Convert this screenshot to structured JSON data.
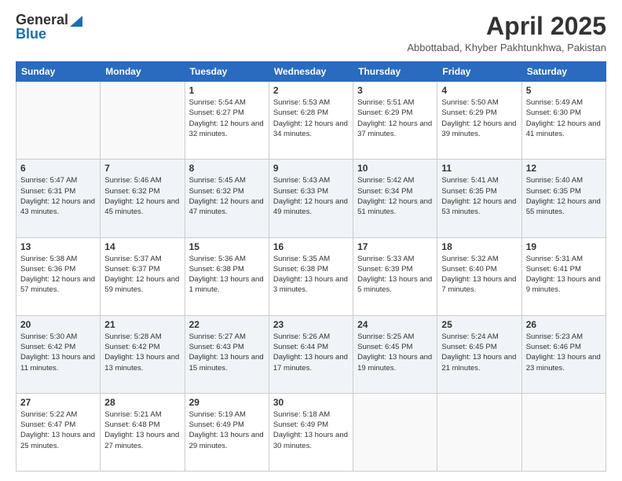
{
  "logo": {
    "general": "General",
    "blue": "Blue"
  },
  "title": {
    "month": "April 2025",
    "location": "Abbottabad, Khyber Pakhtunkhwa, Pakistan"
  },
  "days_of_week": [
    "Sunday",
    "Monday",
    "Tuesday",
    "Wednesday",
    "Thursday",
    "Friday",
    "Saturday"
  ],
  "weeks": [
    [
      {
        "day": "",
        "info": ""
      },
      {
        "day": "",
        "info": ""
      },
      {
        "day": "1",
        "info": "Sunrise: 5:54 AM\nSunset: 6:27 PM\nDaylight: 12 hours and 32 minutes."
      },
      {
        "day": "2",
        "info": "Sunrise: 5:53 AM\nSunset: 6:28 PM\nDaylight: 12 hours and 34 minutes."
      },
      {
        "day": "3",
        "info": "Sunrise: 5:51 AM\nSunset: 6:29 PM\nDaylight: 12 hours and 37 minutes."
      },
      {
        "day": "4",
        "info": "Sunrise: 5:50 AM\nSunset: 6:29 PM\nDaylight: 12 hours and 39 minutes."
      },
      {
        "day": "5",
        "info": "Sunrise: 5:49 AM\nSunset: 6:30 PM\nDaylight: 12 hours and 41 minutes."
      }
    ],
    [
      {
        "day": "6",
        "info": "Sunrise: 5:47 AM\nSunset: 6:31 PM\nDaylight: 12 hours and 43 minutes."
      },
      {
        "day": "7",
        "info": "Sunrise: 5:46 AM\nSunset: 6:32 PM\nDaylight: 12 hours and 45 minutes."
      },
      {
        "day": "8",
        "info": "Sunrise: 5:45 AM\nSunset: 6:32 PM\nDaylight: 12 hours and 47 minutes."
      },
      {
        "day": "9",
        "info": "Sunrise: 5:43 AM\nSunset: 6:33 PM\nDaylight: 12 hours and 49 minutes."
      },
      {
        "day": "10",
        "info": "Sunrise: 5:42 AM\nSunset: 6:34 PM\nDaylight: 12 hours and 51 minutes."
      },
      {
        "day": "11",
        "info": "Sunrise: 5:41 AM\nSunset: 6:35 PM\nDaylight: 12 hours and 53 minutes."
      },
      {
        "day": "12",
        "info": "Sunrise: 5:40 AM\nSunset: 6:35 PM\nDaylight: 12 hours and 55 minutes."
      }
    ],
    [
      {
        "day": "13",
        "info": "Sunrise: 5:38 AM\nSunset: 6:36 PM\nDaylight: 12 hours and 57 minutes."
      },
      {
        "day": "14",
        "info": "Sunrise: 5:37 AM\nSunset: 6:37 PM\nDaylight: 12 hours and 59 minutes."
      },
      {
        "day": "15",
        "info": "Sunrise: 5:36 AM\nSunset: 6:38 PM\nDaylight: 13 hours and 1 minute."
      },
      {
        "day": "16",
        "info": "Sunrise: 5:35 AM\nSunset: 6:38 PM\nDaylight: 13 hours and 3 minutes."
      },
      {
        "day": "17",
        "info": "Sunrise: 5:33 AM\nSunset: 6:39 PM\nDaylight: 13 hours and 5 minutes."
      },
      {
        "day": "18",
        "info": "Sunrise: 5:32 AM\nSunset: 6:40 PM\nDaylight: 13 hours and 7 minutes."
      },
      {
        "day": "19",
        "info": "Sunrise: 5:31 AM\nSunset: 6:41 PM\nDaylight: 13 hours and 9 minutes."
      }
    ],
    [
      {
        "day": "20",
        "info": "Sunrise: 5:30 AM\nSunset: 6:42 PM\nDaylight: 13 hours and 11 minutes."
      },
      {
        "day": "21",
        "info": "Sunrise: 5:28 AM\nSunset: 6:42 PM\nDaylight: 13 hours and 13 minutes."
      },
      {
        "day": "22",
        "info": "Sunrise: 5:27 AM\nSunset: 6:43 PM\nDaylight: 13 hours and 15 minutes."
      },
      {
        "day": "23",
        "info": "Sunrise: 5:26 AM\nSunset: 6:44 PM\nDaylight: 13 hours and 17 minutes."
      },
      {
        "day": "24",
        "info": "Sunrise: 5:25 AM\nSunset: 6:45 PM\nDaylight: 13 hours and 19 minutes."
      },
      {
        "day": "25",
        "info": "Sunrise: 5:24 AM\nSunset: 6:45 PM\nDaylight: 13 hours and 21 minutes."
      },
      {
        "day": "26",
        "info": "Sunrise: 5:23 AM\nSunset: 6:46 PM\nDaylight: 13 hours and 23 minutes."
      }
    ],
    [
      {
        "day": "27",
        "info": "Sunrise: 5:22 AM\nSunset: 6:47 PM\nDaylight: 13 hours and 25 minutes."
      },
      {
        "day": "28",
        "info": "Sunrise: 5:21 AM\nSunset: 6:48 PM\nDaylight: 13 hours and 27 minutes."
      },
      {
        "day": "29",
        "info": "Sunrise: 5:19 AM\nSunset: 6:49 PM\nDaylight: 13 hours and 29 minutes."
      },
      {
        "day": "30",
        "info": "Sunrise: 5:18 AM\nSunset: 6:49 PM\nDaylight: 13 hours and 30 minutes."
      },
      {
        "day": "",
        "info": ""
      },
      {
        "day": "",
        "info": ""
      },
      {
        "day": "",
        "info": ""
      }
    ]
  ]
}
